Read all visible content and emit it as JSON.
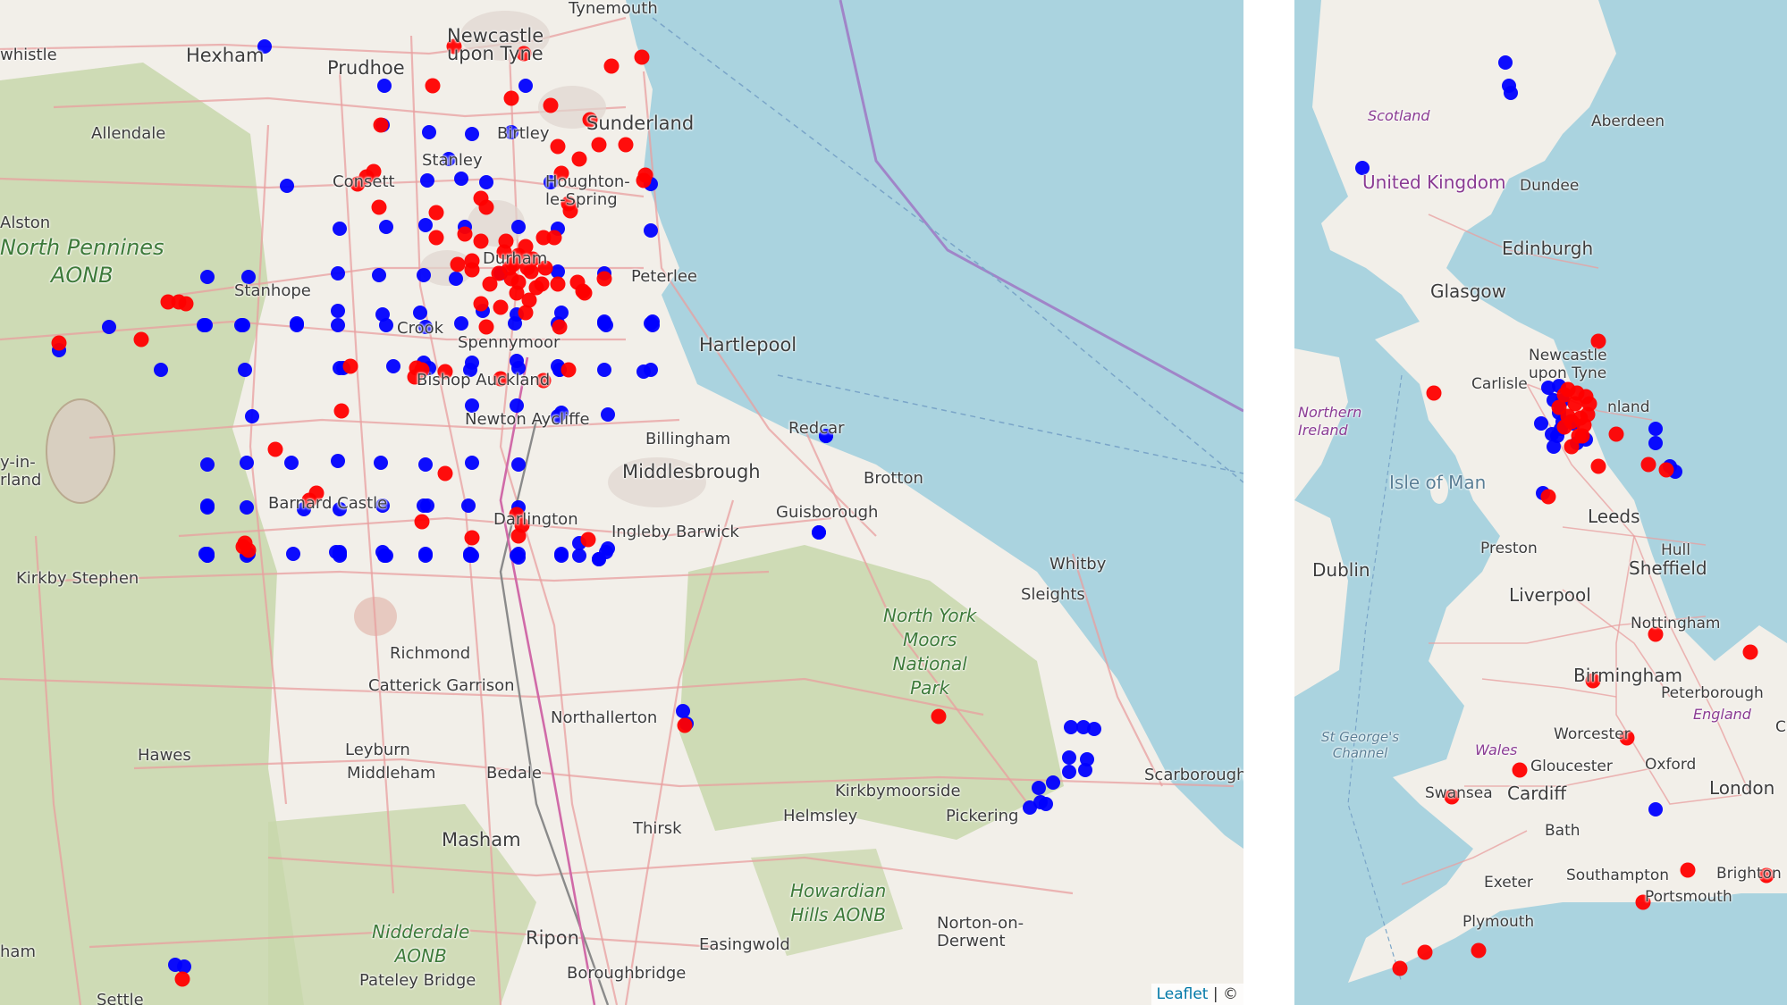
{
  "colors": {
    "blue_marker": "#0000ff",
    "red_marker": "#ff0000",
    "sea": "#aad3df",
    "land": "#f2efe9",
    "park": "#c8d7ab"
  },
  "left_map": {
    "attribution": {
      "link": "Leaflet",
      "separator": " | ©"
    },
    "labels": [
      "whistle",
      "Hexham",
      "Prudhoe",
      "Newcastle\nupon Tyne",
      "Tynemouth",
      "Sunderland",
      "Allendale",
      "Birtley",
      "Stanley",
      "Consett",
      "Houghton-\nle-Spring",
      "Alston",
      "Durham",
      "Peterlee",
      "Stanhope",
      "Crook",
      "Spennymoor",
      "Hartlepool",
      "Bishop Auckland",
      "Newton Aycliffe",
      "Billingham",
      "Redcar",
      "Middlesbrough",
      "Brotton",
      "Barnard Castle",
      "Darlington",
      "Ingleby Barwick",
      "Guisborough",
      "y-in-\nrland",
      "Kirkby Stephen",
      "Whitby",
      "Sleights",
      "Richmond",
      "Catterick Garrison",
      "Northallerton",
      "Hawes",
      "Leyburn",
      "Middleham",
      "Bedale",
      "Kirkbymoorside",
      "Helmsley",
      "Pickering",
      "Scarborough",
      "Thirsk",
      "Masham",
      "Ripon",
      "Easingwold",
      "Norton-on-\nDerwent",
      "Boroughbridge",
      "Pateley Bridge",
      "Settle",
      "ham"
    ],
    "parks": [
      "North Pennines\nAONB",
      "North York\nMoors\nNational\nPark",
      "Howardian\nHills AONB",
      "Nidderdale\nAONB"
    ],
    "blue_markers": 82,
    "red_markers": 80
  },
  "right_map": {
    "labels": [
      "Aberdeen",
      "Dundee",
      "Edinburgh",
      "Glasgow",
      "Newcastle\nupon Tyne",
      "Carlisle",
      "nland",
      "Leeds",
      "Preston",
      "Hull",
      "Sheffield",
      "Dublin",
      "Liverpool",
      "Nottingham",
      "Birmingham",
      "Peterborough",
      "Worcester",
      "Gloucester",
      "Oxford",
      "Cardiff",
      "Swansea",
      "London",
      "Bath",
      "Exeter",
      "Southampton",
      "Portsmouth",
      "Brighton",
      "Plymouth",
      "Ca"
    ],
    "countries": [
      "United Kingdom"
    ],
    "regions": [
      "Scotland",
      "Wales",
      "England",
      "Northern\nIreland"
    ],
    "seas": [
      "Isle of Man",
      "St George's\nChannel"
    ],
    "blue_markers": 16,
    "red_markers": 20
  }
}
